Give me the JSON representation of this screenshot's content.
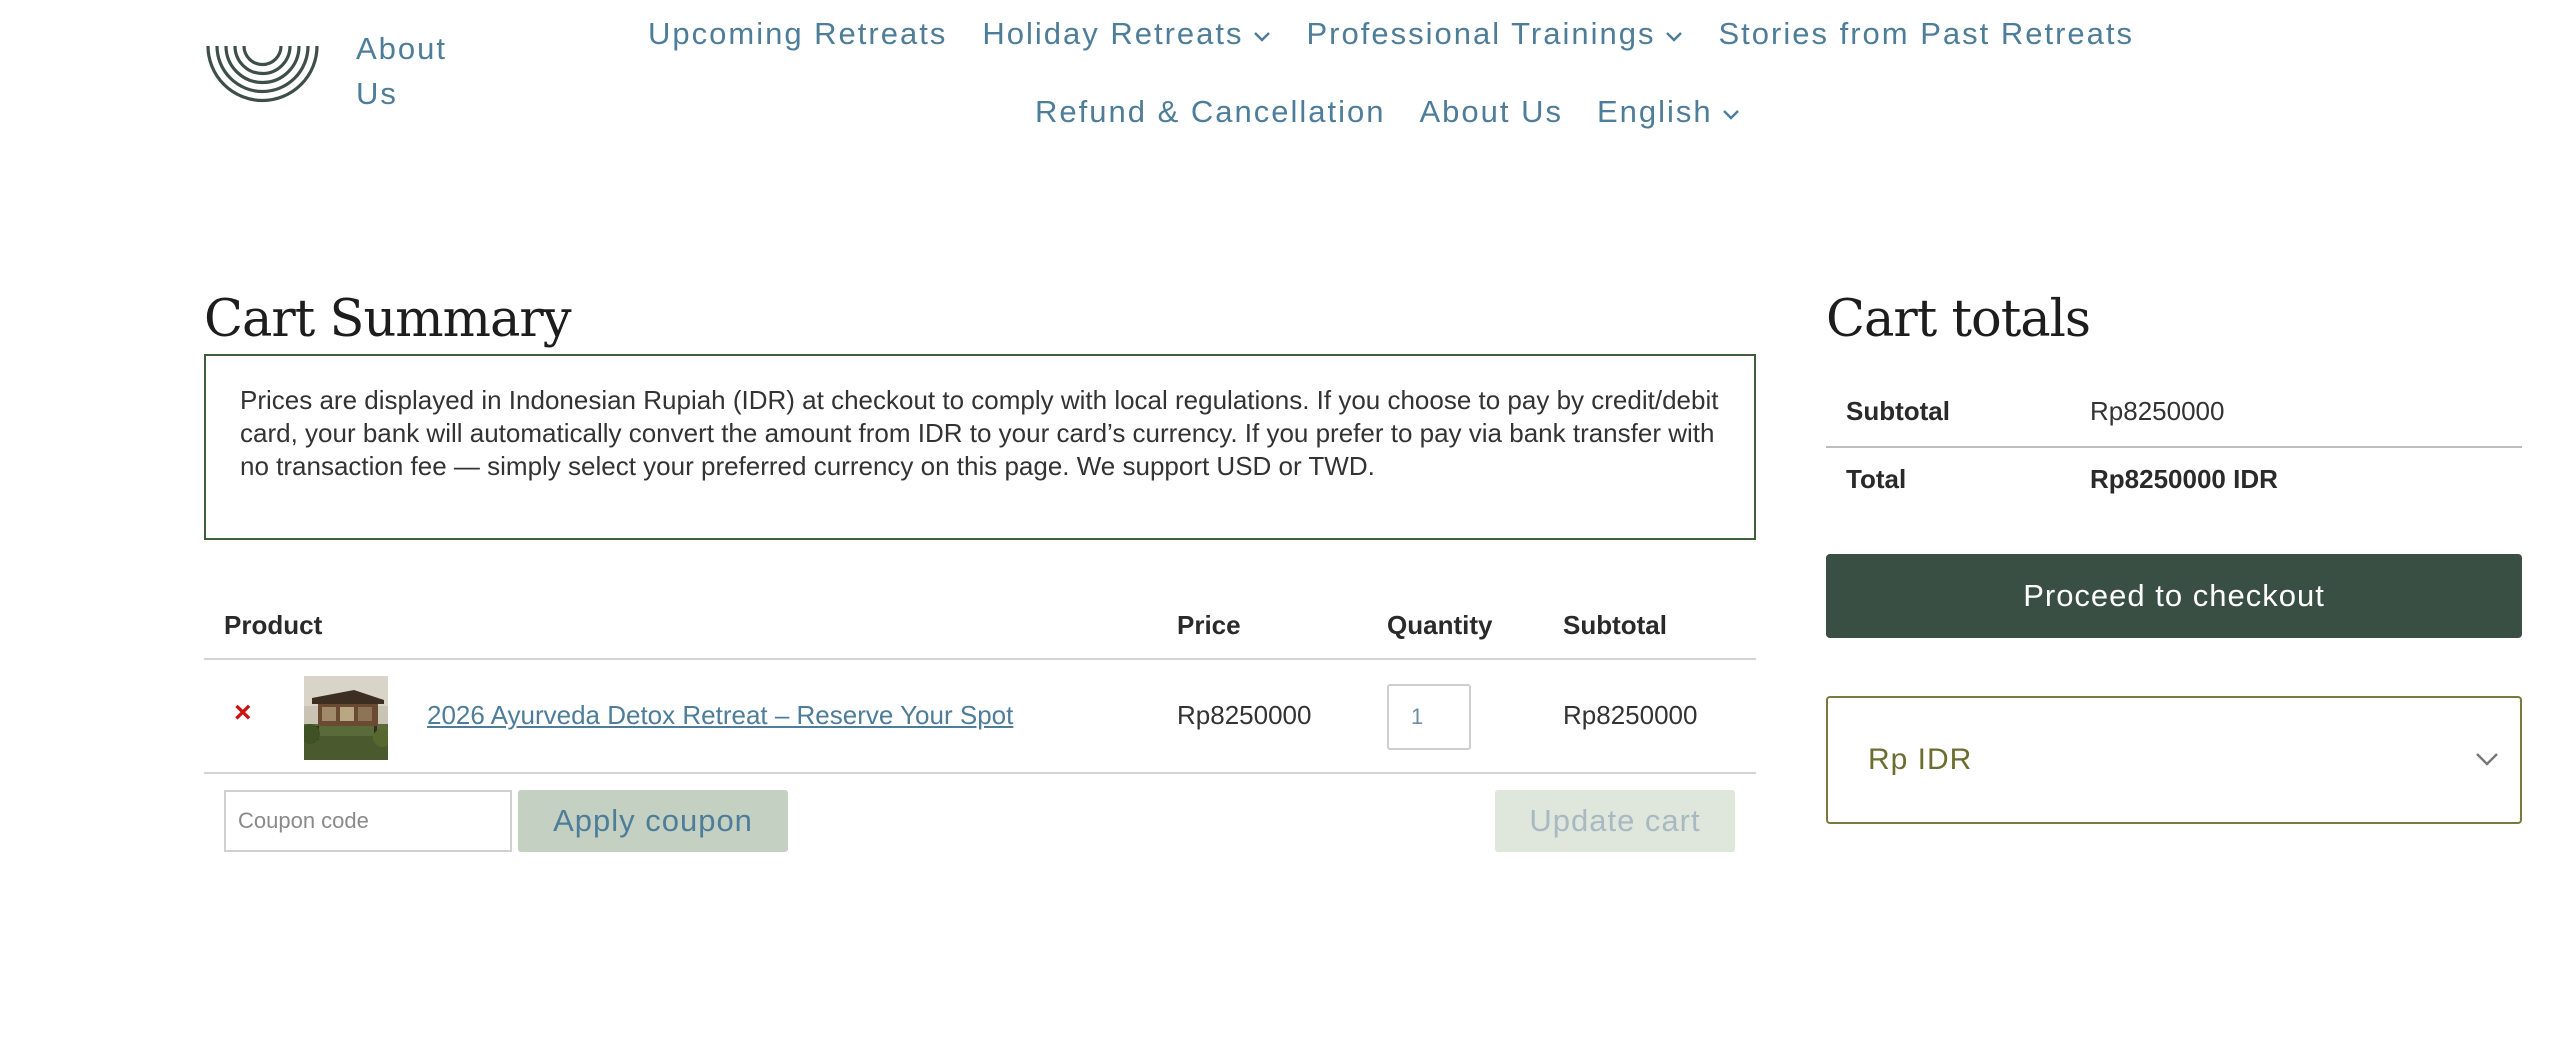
{
  "header": {
    "logo_icon": "rainbow-arcs-logo",
    "about_link": "About Us",
    "nav_row1": [
      {
        "label": "Upcoming Retreats",
        "has_dropdown": false
      },
      {
        "label": "Holiday Retreats",
        "has_dropdown": true
      },
      {
        "label": "Professional Trainings",
        "has_dropdown": true
      },
      {
        "label": "Stories from Past Retreats",
        "has_dropdown": false
      }
    ],
    "nav_row2": [
      {
        "label": "Refund & Cancellation",
        "has_dropdown": false
      },
      {
        "label": "About Us",
        "has_dropdown": false
      },
      {
        "label": "English",
        "has_dropdown": true
      }
    ],
    "nav_color": "#4e7d99"
  },
  "cart_summary": {
    "title": "Cart Summary",
    "notice": "Prices are displayed in Indonesian Rupiah (IDR) at checkout to comply with local regulations. If you choose to pay by credit/debit card, your bank will automatically convert the amount from IDR to your card’s currency. If you prefer to pay via bank transfer with no transaction fee — simply select your preferred currency on this page. We support USD or TWD.",
    "table": {
      "headers": {
        "product": "Product",
        "price": "Price",
        "quantity": "Quantity",
        "subtotal": "Subtotal"
      },
      "rows": [
        {
          "remove_icon": "close-icon",
          "product_name": "2026 Ayurveda Detox Retreat – Reserve Your Spot",
          "price": "Rp8250000",
          "quantity": "1",
          "subtotal": "Rp8250000"
        }
      ]
    },
    "coupon_placeholder": "Coupon code",
    "apply_coupon_label": "Apply coupon",
    "update_cart_label": "Update cart"
  },
  "cart_totals": {
    "title": "Cart totals",
    "subtotal_label": "Subtotal",
    "subtotal_value": "Rp8250000",
    "total_label": "Total",
    "total_value": "Rp8250000 IDR",
    "checkout_label": "Proceed to checkout",
    "currency_selected": "Rp IDR",
    "accent_color": "#3a4f44"
  }
}
